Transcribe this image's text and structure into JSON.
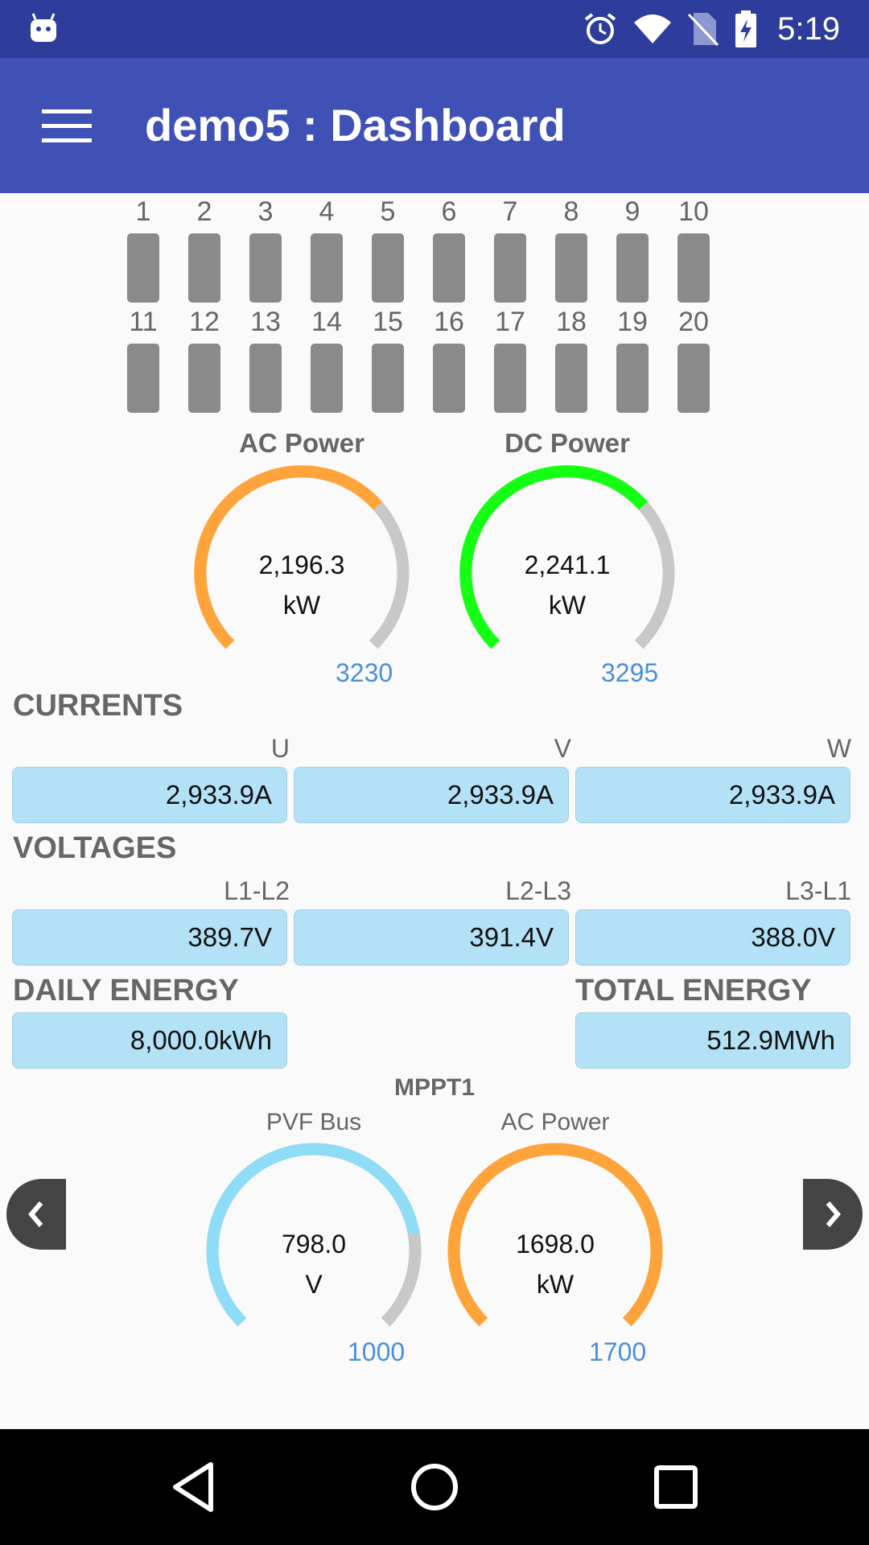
{
  "status_bar": {
    "time": "5:19"
  },
  "app_bar": {
    "title": "demo5 : Dashboard"
  },
  "strings": {
    "row1": [
      "1",
      "2",
      "3",
      "4",
      "5",
      "6",
      "7",
      "8",
      "9",
      "10"
    ],
    "row2": [
      "11",
      "12",
      "13",
      "14",
      "15",
      "16",
      "17",
      "18",
      "19",
      "20"
    ]
  },
  "gauges_top": [
    {
      "title": "AC Power",
      "value": "2,196.3",
      "unit": "kW",
      "max": "3230",
      "fraction": 0.68,
      "color": "#ffa43a"
    },
    {
      "title": "DC Power",
      "value": "2,241.1",
      "unit": "kW",
      "max": "3295",
      "fraction": 0.68,
      "color": "#14ff14"
    }
  ],
  "currents": {
    "title": "CURRENTS",
    "labels": [
      "U",
      "V",
      "W"
    ],
    "values": [
      "2,933.9A",
      "2,933.9A",
      "2,933.9A"
    ]
  },
  "voltages": {
    "title": "VOLTAGES",
    "labels": [
      "L1-L2",
      "L2-L3",
      "L3-L1"
    ],
    "values": [
      "389.7V",
      "391.4V",
      "388.0V"
    ]
  },
  "energy": {
    "daily_title": "DAILY ENERGY",
    "daily_value": "8,000.0kWh",
    "total_title": "TOTAL ENERGY",
    "total_value": "512.9MWh"
  },
  "mppt": {
    "title": "MPPT1",
    "gauges": [
      {
        "title": "PVF Bus",
        "value": "798.0",
        "unit": "V",
        "max": "1000",
        "fraction": 0.798,
        "color": "#8fdcf7"
      },
      {
        "title": "AC Power",
        "value": "1698.0",
        "unit": "kW",
        "max": "1700",
        "fraction": 0.999,
        "color": "#ffa43a"
      }
    ]
  },
  "colors": {
    "status_bar": "#2e3d9b",
    "app_bar": "#3f51b5",
    "field_bg": "#b3e1f6",
    "gauge_track": "#c8c8c8",
    "max_label": "#4a90d9"
  },
  "icons": {
    "left_arrow": "chevron-left-icon",
    "right_arrow": "chevron-right-icon"
  }
}
